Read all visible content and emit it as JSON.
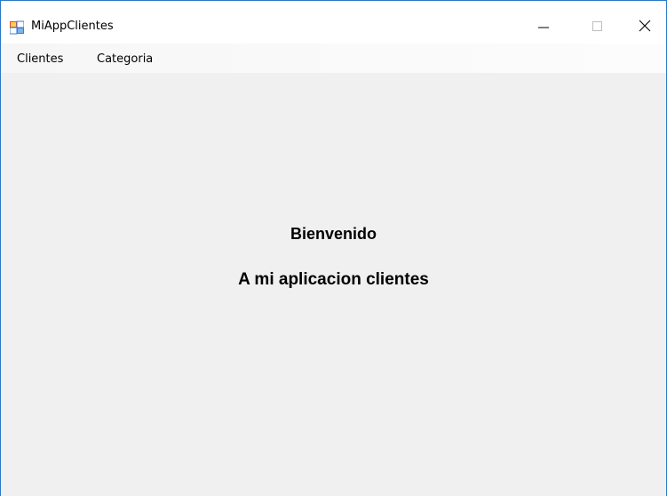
{
  "window": {
    "title": "MiAppClientes",
    "app_icon": "windows-forms-app-icon",
    "controls": {
      "minimize_icon": "minimize-icon",
      "maximize_icon": "maximize-icon",
      "close_icon": "close-icon"
    }
  },
  "menubar": {
    "items": [
      {
        "label": "Clientes"
      },
      {
        "label": "Categoria"
      }
    ]
  },
  "main": {
    "welcome_line1": "Bienvenido",
    "welcome_line2": "A mi aplicacion clientes"
  },
  "colors": {
    "window_border": "#2b79c9",
    "client_background": "#f0f0f0",
    "titlebar_background": "#ffffff"
  }
}
